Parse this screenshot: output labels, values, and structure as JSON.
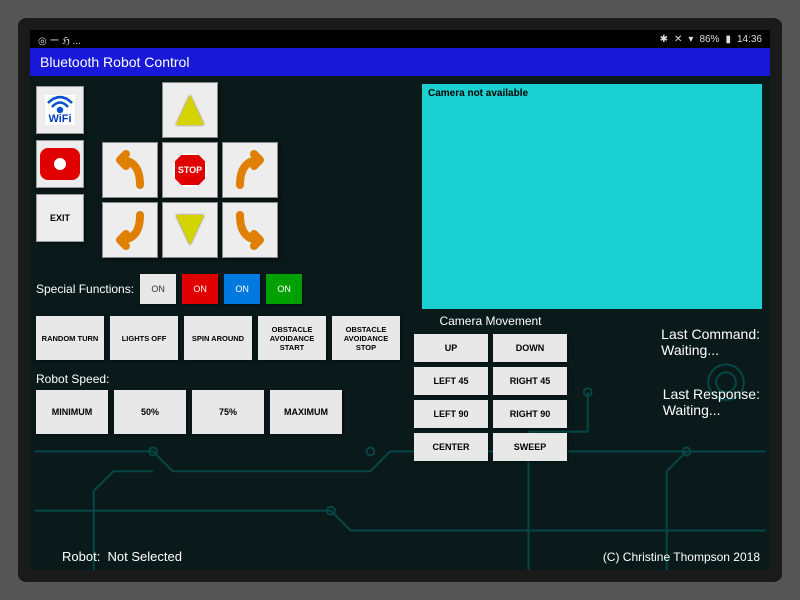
{
  "statusbar": {
    "left": "◎ ー ℌ ...",
    "bt_icon": "✱",
    "mute_icon": "✕",
    "wifi_icon": "▾",
    "battery": "86%",
    "time": "14:36"
  },
  "app_title": "Bluetooth Robot Control",
  "side": {
    "wifi_label": "WiFi",
    "exit_label": "EXIT"
  },
  "dpad": {
    "stop_label": "STOP"
  },
  "camera": {
    "na_label": "Camera not available"
  },
  "special": {
    "label": "Special Functions:",
    "toggles": [
      "ON",
      "ON",
      "ON",
      "ON"
    ]
  },
  "functions": [
    "RANDOM TURN",
    "LIGHTS OFF",
    "SPIN AROUND",
    "OBSTACLE AVOIDANCE START",
    "OBSTACLE AVOIDANCE STOP"
  ],
  "speed": {
    "label": "Robot Speed:",
    "options": [
      "MINIMUM",
      "50%",
      "75%",
      "MAXIMUM"
    ]
  },
  "cammove": {
    "label": "Camera Movement",
    "buttons": [
      "UP",
      "DOWN",
      "LEFT 45",
      "RIGHT 45",
      "LEFT 90",
      "RIGHT 90",
      "CENTER",
      "SWEEP"
    ]
  },
  "status": {
    "cmd_label": "Last Command:",
    "cmd_value": "Waiting...",
    "resp_label": "Last Response:",
    "resp_value": "Waiting..."
  },
  "robot": {
    "label": "Robot:",
    "value": "Not Selected"
  },
  "copyright": "(C) Christine Thompson 2018"
}
